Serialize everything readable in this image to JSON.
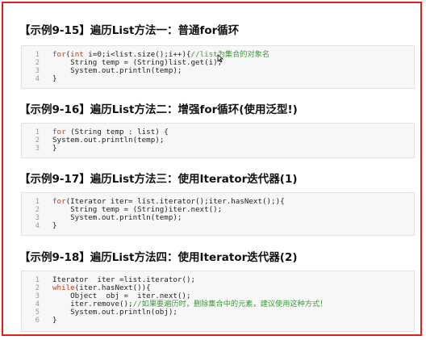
{
  "sections": [
    {
      "title": "【示例9-15】遍历List方法一：普通for循环",
      "lines": [
        [
          {
            "t": "for",
            "k": "kw"
          },
          {
            "t": "(",
            "k": ""
          },
          {
            "t": "int",
            "k": "kw"
          },
          {
            "t": " i=0;i<list.size();i++){",
            "k": ""
          },
          {
            "t": "//list为集合的对象名",
            "k": "cm"
          }
        ],
        [
          {
            "t": "    String temp = (String)list.get(i);",
            "k": ""
          }
        ],
        [
          {
            "t": "    System.out.println(temp);",
            "k": ""
          }
        ],
        [
          {
            "t": "}",
            "k": ""
          }
        ]
      ]
    },
    {
      "title": "【示例9-16】遍历List方法二：增强for循环(使用泛型!)",
      "lines": [
        [
          {
            "t": "for",
            "k": "kw"
          },
          {
            "t": " (String temp : list) {",
            "k": ""
          }
        ],
        [
          {
            "t": "System.out.println(temp);",
            "k": ""
          }
        ],
        [
          {
            "t": "}",
            "k": ""
          }
        ]
      ]
    },
    {
      "title": "【示例9-17】遍历List方法三：使用Iterator迭代器(1)",
      "lines": [
        [
          {
            "t": "for",
            "k": "kw"
          },
          {
            "t": "(Iterator iter= list.iterator();iter.hasNext();){",
            "k": ""
          }
        ],
        [
          {
            "t": "    String temp = (String)iter.next();",
            "k": ""
          }
        ],
        [
          {
            "t": "    System.out.println(temp);",
            "k": ""
          }
        ],
        [
          {
            "t": "}",
            "k": ""
          }
        ]
      ]
    },
    {
      "title": "【示例9-18】遍历List方法四：使用Iterator迭代器(2)",
      "lines": [
        [
          {
            "t": "Iterator  iter =list.iterator();",
            "k": ""
          }
        ],
        [
          {
            "t": "while",
            "k": "kw"
          },
          {
            "t": "(iter.hasNext()){",
            "k": ""
          }
        ],
        [
          {
            "t": "    Object  obj =  iter.next();",
            "k": ""
          }
        ],
        [
          {
            "t": "    iter.remove();",
            "k": ""
          },
          {
            "t": "//如果要遍历时，删除集合中的元素，建议使用这种方式！",
            "k": "cm"
          }
        ],
        [
          {
            "t": "    System.out.println(obj);",
            "k": ""
          }
        ],
        [
          {
            "t": "}",
            "k": ""
          }
        ]
      ]
    }
  ],
  "colors": {
    "border": "#e0201b",
    "keyword": "#c03a1a",
    "comment": "#3a9a3a"
  }
}
